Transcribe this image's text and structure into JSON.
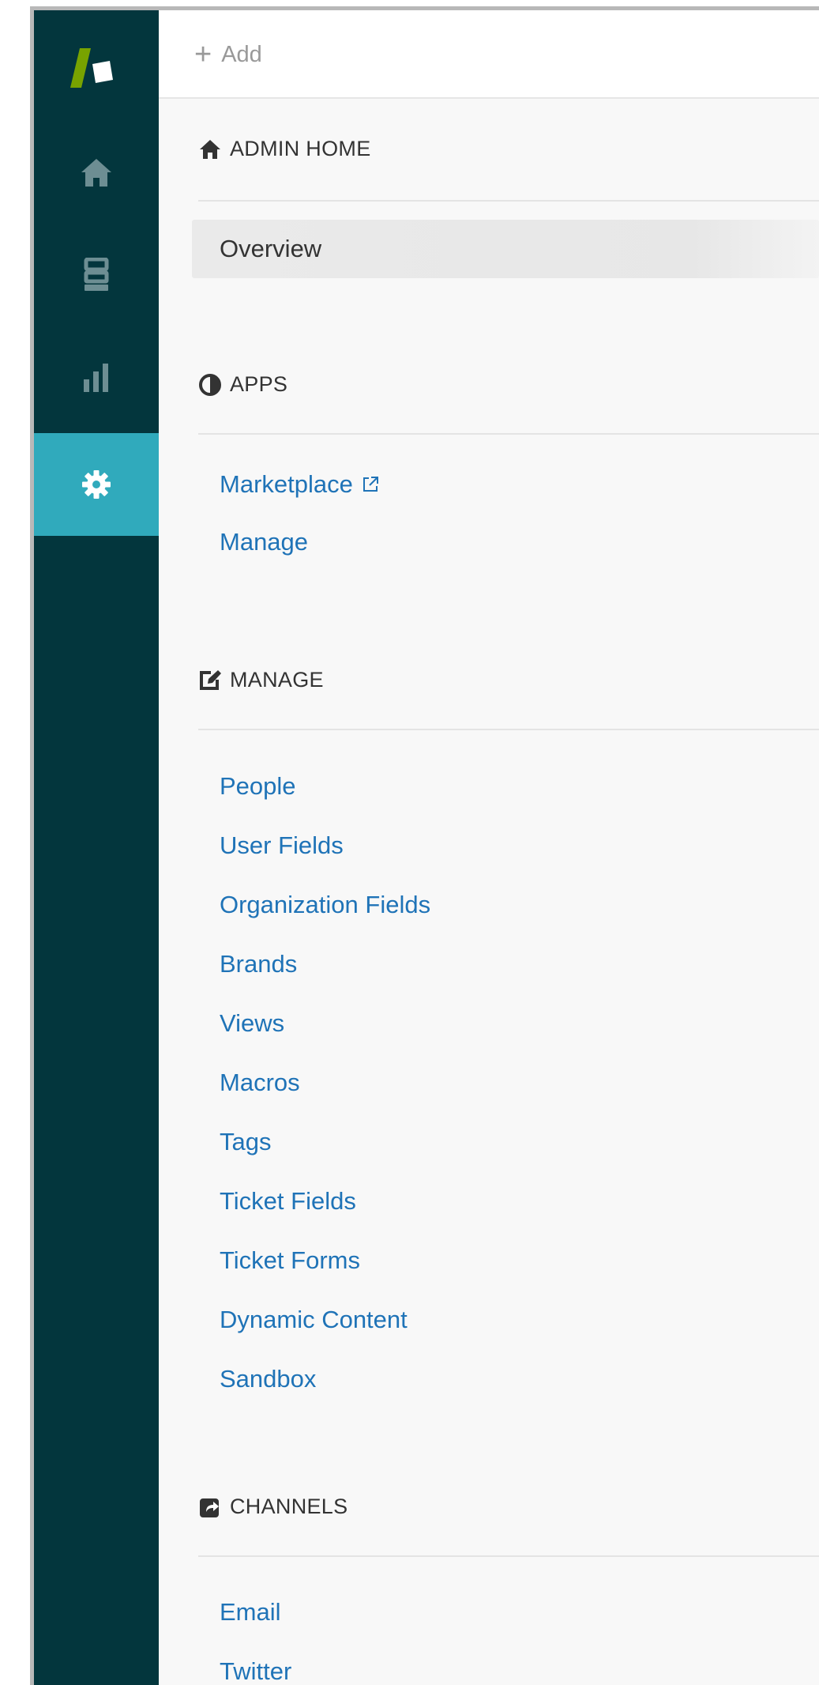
{
  "topbar": {
    "add_label": "Add"
  },
  "rail": {
    "items": [
      {
        "name": "home",
        "icon": "home-icon"
      },
      {
        "name": "views",
        "icon": "views-icon"
      },
      {
        "name": "reporting",
        "icon": "bar-chart-icon"
      },
      {
        "name": "admin",
        "icon": "gear-icon",
        "active": true
      }
    ],
    "active_color": "#30aabc",
    "background_color": "#03363d"
  },
  "sections": {
    "admin_home": {
      "title": "ADMIN HOME",
      "icon": "home-icon",
      "items": [
        {
          "label": "Overview",
          "selected": true
        }
      ]
    },
    "apps": {
      "title": "APPS",
      "icon": "half-circle-icon",
      "items": [
        {
          "label": "Marketplace",
          "external": true
        },
        {
          "label": "Manage"
        }
      ]
    },
    "manage": {
      "title": "MANAGE",
      "icon": "edit-icon",
      "items": [
        {
          "label": "People"
        },
        {
          "label": "User Fields"
        },
        {
          "label": "Organization Fields"
        },
        {
          "label": "Brands"
        },
        {
          "label": "Views"
        },
        {
          "label": "Macros"
        },
        {
          "label": "Tags"
        },
        {
          "label": "Ticket Fields"
        },
        {
          "label": "Ticket Forms"
        },
        {
          "label": "Dynamic Content"
        },
        {
          "label": "Sandbox"
        }
      ]
    },
    "channels": {
      "title": "CHANNELS",
      "icon": "share-icon",
      "items": [
        {
          "label": "Email"
        },
        {
          "label": "Twitter"
        }
      ]
    }
  },
  "colors": {
    "link": "#1f73b7",
    "header_text": "#333333",
    "add_text": "#999999"
  }
}
